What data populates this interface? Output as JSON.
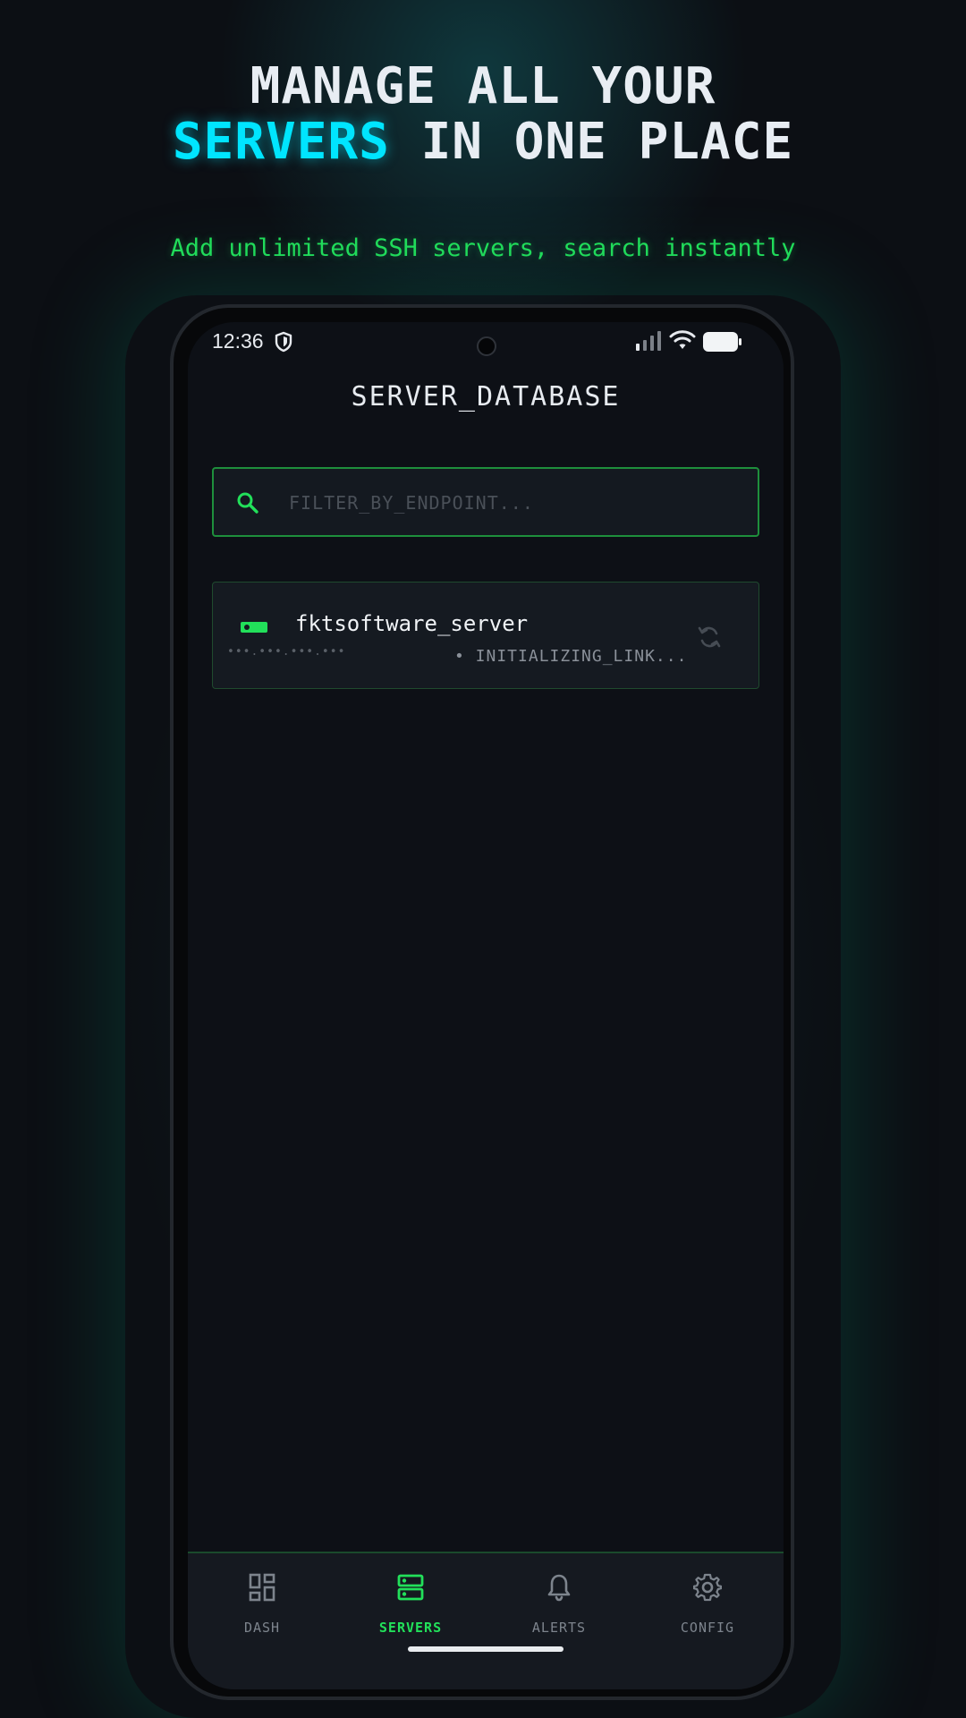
{
  "promo": {
    "headline_line1": "MANAGE ALL YOUR",
    "headline_accent": "SERVERS",
    "headline_rest": "IN ONE PLACE",
    "subheadline": "Add unlimited SSH servers, search instantly",
    "accent_color": "#00e5ff",
    "subheadline_color": "#22e05a"
  },
  "status_bar": {
    "time": "12:36",
    "icons": [
      "shield-icon",
      "signal-icon",
      "wifi-icon",
      "battery-icon"
    ]
  },
  "app": {
    "title": "SERVER_DATABASE",
    "accent_color": "#22e05a"
  },
  "search": {
    "placeholder": "FILTER_BY_ENDPOINT...",
    "value": ""
  },
  "servers": [
    {
      "name": "fktsoftware_server",
      "ip_masked": "•••.•••.•••.•••",
      "status": "• INITIALIZING_LINK...",
      "icon": "server-icon",
      "action_icon": "refresh-icon"
    }
  ],
  "nav": {
    "items": [
      {
        "label": "DASH",
        "icon": "dashboard-icon",
        "active": false
      },
      {
        "label": "SERVERS",
        "icon": "servers-icon",
        "active": true
      },
      {
        "label": "ALERTS",
        "icon": "bell-icon",
        "active": false
      },
      {
        "label": "CONFIG",
        "icon": "gear-icon",
        "active": false
      }
    ]
  }
}
